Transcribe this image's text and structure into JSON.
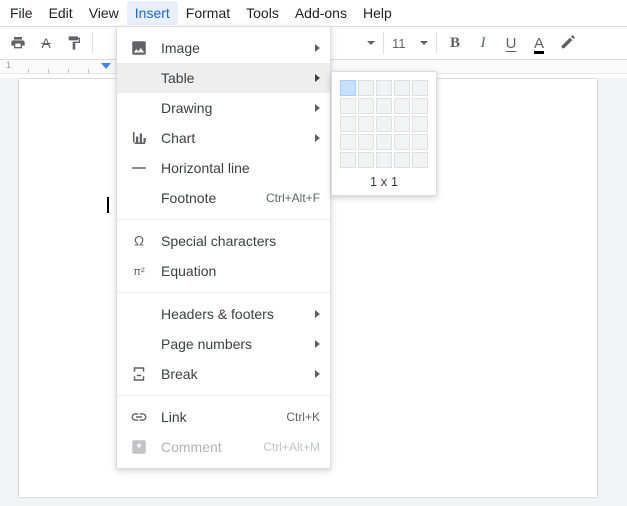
{
  "menubar": [
    {
      "label": "File",
      "active": false
    },
    {
      "label": "Edit",
      "active": false
    },
    {
      "label": "View",
      "active": false
    },
    {
      "label": "Insert",
      "active": true
    },
    {
      "label": "Format",
      "active": false
    },
    {
      "label": "Tools",
      "active": false
    },
    {
      "label": "Add-ons",
      "active": false
    },
    {
      "label": "Help",
      "active": false
    }
  ],
  "toolbar": {
    "font_size": "11",
    "bold": "B",
    "italic": "I",
    "underline": "U",
    "text_color": "A"
  },
  "insert_menu": [
    {
      "kind": "item",
      "icon": "image-icon",
      "label": "Image",
      "sub": true
    },
    {
      "kind": "item",
      "icon": "",
      "label": "Table",
      "sub": true,
      "hover": true
    },
    {
      "kind": "item",
      "icon": "",
      "label": "Drawing",
      "sub": true
    },
    {
      "kind": "item",
      "icon": "chart-icon",
      "label": "Chart",
      "sub": true
    },
    {
      "kind": "item",
      "icon": "hr-icon",
      "label": "Horizontal line"
    },
    {
      "kind": "item",
      "icon": "",
      "label": "Footnote",
      "shortcut": "Ctrl+Alt+F"
    },
    {
      "kind": "sep"
    },
    {
      "kind": "item",
      "icon": "omega-icon",
      "label": "Special characters"
    },
    {
      "kind": "item",
      "icon": "pi-icon",
      "label": "Equation"
    },
    {
      "kind": "sep"
    },
    {
      "kind": "item",
      "icon": "",
      "label": "Headers & footers",
      "sub": true
    },
    {
      "kind": "item",
      "icon": "",
      "label": "Page numbers",
      "sub": true
    },
    {
      "kind": "item",
      "icon": "break-icon",
      "label": "Break",
      "sub": true
    },
    {
      "kind": "sep"
    },
    {
      "kind": "item",
      "icon": "link-icon",
      "label": "Link",
      "shortcut": "Ctrl+K"
    },
    {
      "kind": "item",
      "icon": "comment-icon",
      "label": "Comment",
      "shortcut": "Ctrl+Alt+M",
      "disabled": true
    }
  ],
  "table_picker": {
    "rows": 5,
    "cols": 5,
    "sel_rows": 1,
    "sel_cols": 1,
    "label": "1 x 1"
  },
  "ruler": {
    "num1": "1"
  }
}
